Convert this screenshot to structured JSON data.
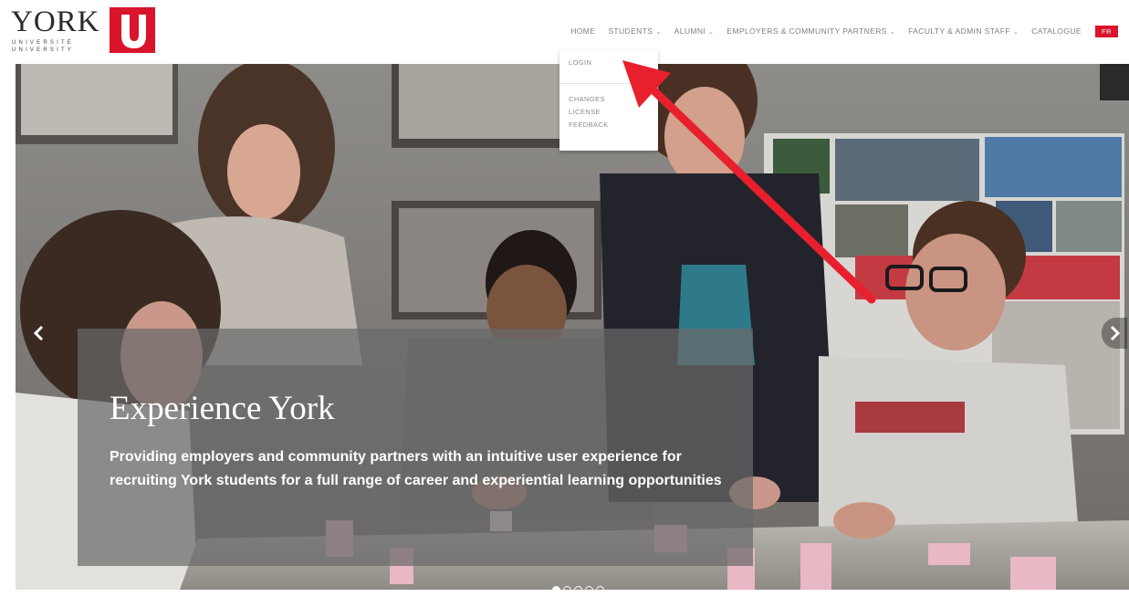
{
  "brand": {
    "name": "YORK",
    "subtitle_1": "UNIVERSITÉ",
    "subtitle_2": "UNIVERSITY",
    "mark_letter": "U",
    "color": "#d9142b"
  },
  "nav": {
    "items": [
      {
        "label": "HOME",
        "has_dropdown": false
      },
      {
        "label": "STUDENTS",
        "has_dropdown": true
      },
      {
        "label": "ALUMNI",
        "has_dropdown": true
      },
      {
        "label": "EMPLOYERS & COMMUNITY PARTNERS",
        "has_dropdown": true
      },
      {
        "label": "FACULTY & ADMIN STAFF",
        "has_dropdown": true
      },
      {
        "label": "CATALOGUE",
        "has_dropdown": false
      }
    ],
    "language_button": "FR",
    "chevron_icon": "chevron-down-icon"
  },
  "dropdown": {
    "items": [
      {
        "label": "LOGIN"
      },
      {
        "label": "CHANGES"
      },
      {
        "label": "LICENSE"
      },
      {
        "label": "FEEDBACK"
      }
    ]
  },
  "hero": {
    "title": "Experience York",
    "text": "Providing employers and community partners with an intuitive user experience for recruiting York students for a full range of career and experiential learning opportunities",
    "prev_icon": "chevron-left-icon",
    "next_icon": "chevron-right-icon",
    "slide_count": 5,
    "active_slide": 1
  },
  "annotation": {
    "icon": "arrow-annotation",
    "color": "#e8202e"
  }
}
